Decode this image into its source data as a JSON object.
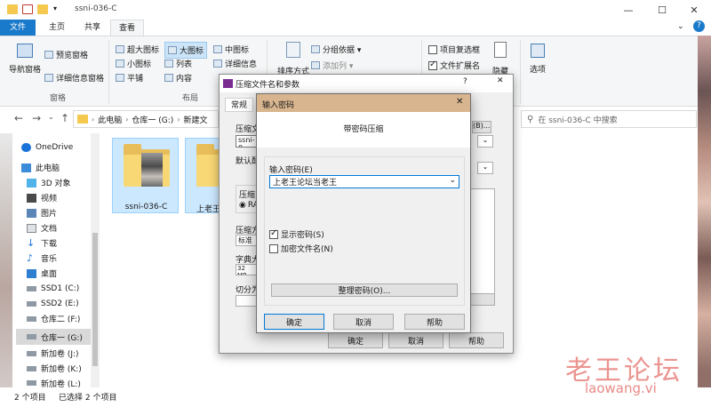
{
  "window": {
    "title": "ssni-036-C",
    "controls": {
      "minimize": "—",
      "maximize": "☐",
      "close": "✕"
    },
    "help": "?"
  },
  "ribbon": {
    "tabs": [
      "文件",
      "主页",
      "共享",
      "查看"
    ],
    "nav_pane": {
      "nav_label": "导航窗格",
      "preview": "预览窗格",
      "details": "详细信息窗格",
      "group": "窗格"
    },
    "layout": {
      "items": [
        "超大图标",
        "大图标",
        "中图标",
        "小图标",
        "列表",
        "详细信息",
        "平铺",
        "内容"
      ],
      "group": "布局"
    },
    "current_view": {
      "sort": "排序方式",
      "group_by": "分组依据 ▾",
      "add_column": "添加列 ▾"
    },
    "show_hide": {
      "item_checkbox": "项目复选框",
      "file_ext": "文件扩展名",
      "hidden": "隐藏"
    },
    "options": "选项"
  },
  "address": {
    "path": [
      "此电脑",
      "仓库一 (G:)",
      "新建文"
    ],
    "search_placeholder": "在 ssni-036-C 中搜索"
  },
  "nav": {
    "items": [
      "OneDrive",
      "此电脑",
      "3D 对象",
      "视频",
      "图片",
      "文档",
      "下载",
      "音乐",
      "桌面",
      "SSD1 (C:)",
      "SSD2 (E:)",
      "仓库二 (F:)",
      "仓库一 (G:)",
      "新加卷 (J:)",
      "新加卷 (K:)",
      "新加卷 (L:)"
    ]
  },
  "files": [
    {
      "name": "ssni-036-C"
    },
    {
      "name": "上老王论"
    }
  ],
  "status": {
    "count": "2 个项目",
    "selected": "已选择 2 个项目"
  },
  "archive_dialog": {
    "title": "压缩文件名和参数",
    "tab": "常规",
    "labels": {
      "archive_name": "压缩文",
      "archive_value": "ssni-0:",
      "default": "默认配",
      "format": "压缩",
      "format_opt": "RA",
      "method": "压缩方",
      "method_value": "标准",
      "dict": "字典大",
      "dict_value": "32 MB",
      "split": "切分为"
    },
    "browse": "(B)...",
    "buttons": {
      "ok": "确定",
      "cancel": "取消",
      "help": "帮助"
    }
  },
  "password_dialog": {
    "title": "输入密码",
    "heading": "带密码压缩",
    "enter_label": "输入密码(E)",
    "password_value": "上老王论坛当老王",
    "show_password": "显示密码(S)",
    "encrypt_names": "加密文件名(N)",
    "organize": "整理密码(O)...",
    "buttons": {
      "ok": "确定",
      "cancel": "取消",
      "help": "帮助"
    }
  },
  "watermark": {
    "text": "老王论坛",
    "url": "laowang.vi"
  }
}
